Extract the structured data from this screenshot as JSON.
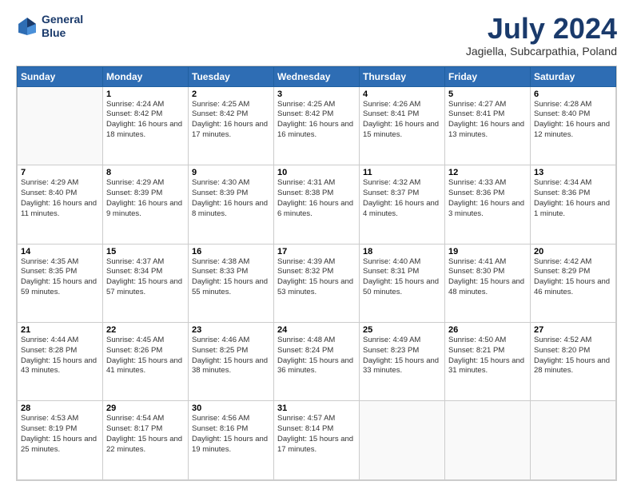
{
  "logo": {
    "line1": "General",
    "line2": "Blue"
  },
  "title": "July 2024",
  "subtitle": "Jagiella, Subcarpathia, Poland",
  "days_of_week": [
    "Sunday",
    "Monday",
    "Tuesday",
    "Wednesday",
    "Thursday",
    "Friday",
    "Saturday"
  ],
  "weeks": [
    [
      {
        "day": "",
        "detail": ""
      },
      {
        "day": "1",
        "detail": "Sunrise: 4:24 AM\nSunset: 8:42 PM\nDaylight: 16 hours\nand 18 minutes."
      },
      {
        "day": "2",
        "detail": "Sunrise: 4:25 AM\nSunset: 8:42 PM\nDaylight: 16 hours\nand 17 minutes."
      },
      {
        "day": "3",
        "detail": "Sunrise: 4:25 AM\nSunset: 8:42 PM\nDaylight: 16 hours\nand 16 minutes."
      },
      {
        "day": "4",
        "detail": "Sunrise: 4:26 AM\nSunset: 8:41 PM\nDaylight: 16 hours\nand 15 minutes."
      },
      {
        "day": "5",
        "detail": "Sunrise: 4:27 AM\nSunset: 8:41 PM\nDaylight: 16 hours\nand 13 minutes."
      },
      {
        "day": "6",
        "detail": "Sunrise: 4:28 AM\nSunset: 8:40 PM\nDaylight: 16 hours\nand 12 minutes."
      }
    ],
    [
      {
        "day": "7",
        "detail": "Sunrise: 4:29 AM\nSunset: 8:40 PM\nDaylight: 16 hours\nand 11 minutes."
      },
      {
        "day": "8",
        "detail": "Sunrise: 4:29 AM\nSunset: 8:39 PM\nDaylight: 16 hours\nand 9 minutes."
      },
      {
        "day": "9",
        "detail": "Sunrise: 4:30 AM\nSunset: 8:39 PM\nDaylight: 16 hours\nand 8 minutes."
      },
      {
        "day": "10",
        "detail": "Sunrise: 4:31 AM\nSunset: 8:38 PM\nDaylight: 16 hours\nand 6 minutes."
      },
      {
        "day": "11",
        "detail": "Sunrise: 4:32 AM\nSunset: 8:37 PM\nDaylight: 16 hours\nand 4 minutes."
      },
      {
        "day": "12",
        "detail": "Sunrise: 4:33 AM\nSunset: 8:36 PM\nDaylight: 16 hours\nand 3 minutes."
      },
      {
        "day": "13",
        "detail": "Sunrise: 4:34 AM\nSunset: 8:36 PM\nDaylight: 16 hours\nand 1 minute."
      }
    ],
    [
      {
        "day": "14",
        "detail": "Sunrise: 4:35 AM\nSunset: 8:35 PM\nDaylight: 15 hours\nand 59 minutes."
      },
      {
        "day": "15",
        "detail": "Sunrise: 4:37 AM\nSunset: 8:34 PM\nDaylight: 15 hours\nand 57 minutes."
      },
      {
        "day": "16",
        "detail": "Sunrise: 4:38 AM\nSunset: 8:33 PM\nDaylight: 15 hours\nand 55 minutes."
      },
      {
        "day": "17",
        "detail": "Sunrise: 4:39 AM\nSunset: 8:32 PM\nDaylight: 15 hours\nand 53 minutes."
      },
      {
        "day": "18",
        "detail": "Sunrise: 4:40 AM\nSunset: 8:31 PM\nDaylight: 15 hours\nand 50 minutes."
      },
      {
        "day": "19",
        "detail": "Sunrise: 4:41 AM\nSunset: 8:30 PM\nDaylight: 15 hours\nand 48 minutes."
      },
      {
        "day": "20",
        "detail": "Sunrise: 4:42 AM\nSunset: 8:29 PM\nDaylight: 15 hours\nand 46 minutes."
      }
    ],
    [
      {
        "day": "21",
        "detail": "Sunrise: 4:44 AM\nSunset: 8:28 PM\nDaylight: 15 hours\nand 43 minutes."
      },
      {
        "day": "22",
        "detail": "Sunrise: 4:45 AM\nSunset: 8:26 PM\nDaylight: 15 hours\nand 41 minutes."
      },
      {
        "day": "23",
        "detail": "Sunrise: 4:46 AM\nSunset: 8:25 PM\nDaylight: 15 hours\nand 38 minutes."
      },
      {
        "day": "24",
        "detail": "Sunrise: 4:48 AM\nSunset: 8:24 PM\nDaylight: 15 hours\nand 36 minutes."
      },
      {
        "day": "25",
        "detail": "Sunrise: 4:49 AM\nSunset: 8:23 PM\nDaylight: 15 hours\nand 33 minutes."
      },
      {
        "day": "26",
        "detail": "Sunrise: 4:50 AM\nSunset: 8:21 PM\nDaylight: 15 hours\nand 31 minutes."
      },
      {
        "day": "27",
        "detail": "Sunrise: 4:52 AM\nSunset: 8:20 PM\nDaylight: 15 hours\nand 28 minutes."
      }
    ],
    [
      {
        "day": "28",
        "detail": "Sunrise: 4:53 AM\nSunset: 8:19 PM\nDaylight: 15 hours\nand 25 minutes."
      },
      {
        "day": "29",
        "detail": "Sunrise: 4:54 AM\nSunset: 8:17 PM\nDaylight: 15 hours\nand 22 minutes."
      },
      {
        "day": "30",
        "detail": "Sunrise: 4:56 AM\nSunset: 8:16 PM\nDaylight: 15 hours\nand 19 minutes."
      },
      {
        "day": "31",
        "detail": "Sunrise: 4:57 AM\nSunset: 8:14 PM\nDaylight: 15 hours\nand 17 minutes."
      },
      {
        "day": "",
        "detail": ""
      },
      {
        "day": "",
        "detail": ""
      },
      {
        "day": "",
        "detail": ""
      }
    ]
  ]
}
